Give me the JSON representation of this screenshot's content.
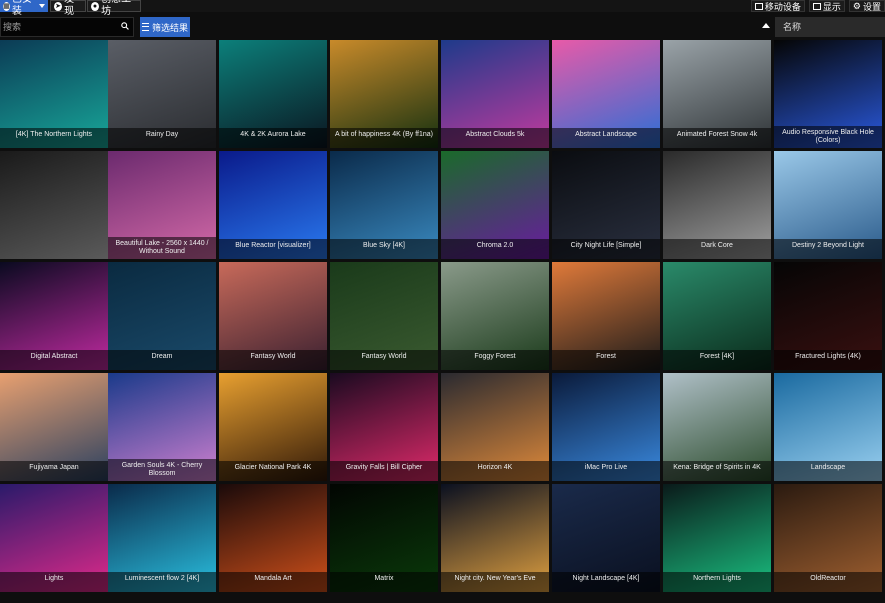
{
  "topbar": {
    "installed_label": "已安装",
    "discover_label": "发现",
    "workshop_label": "创意工坊",
    "mobile_label": "移动设备",
    "display_label": "显示",
    "settings_label": "设置"
  },
  "toolbar": {
    "search_placeholder": "搜索",
    "filter_label": "筛选结果",
    "sort_label": "名称"
  },
  "wallpapers": [
    {
      "title": "[4K] The Northern Lights",
      "colors": [
        "#0b3b55",
        "#18a89a"
      ]
    },
    {
      "title": "Rainy Day",
      "colors": [
        "#5a5e66",
        "#2a2c30"
      ]
    },
    {
      "title": "4K & 2K Aurora Lake",
      "colors": [
        "#0c7f7a",
        "#0b1520"
      ]
    },
    {
      "title": "A bit of happiness 4K (By ff1na)",
      "colors": [
        "#c88a2a",
        "#143010"
      ]
    },
    {
      "title": "Abstract Clouds 5k",
      "colors": [
        "#1e3a8a",
        "#c23a9e"
      ]
    },
    {
      "title": "Abstract Landscape",
      "colors": [
        "#e85aa8",
        "#2a6fd6"
      ]
    },
    {
      "title": "Animated Forest Snow 4k",
      "colors": [
        "#9aa3a8",
        "#2e3336"
      ]
    },
    {
      "title": "Audio Responsive Black Hole (Colors)",
      "colors": [
        "#050505",
        "#2a5ae0"
      ]
    },
    {
      "title": "",
      "colors": [
        "#1a1a1a",
        "#5a5a5a"
      ]
    },
    {
      "title": "Beautiful Lake - 2560 x 1440 / Without Sound",
      "colors": [
        "#6b2a6e",
        "#d46aa8"
      ]
    },
    {
      "title": "Blue Reactor [visualizer]",
      "colors": [
        "#0a1a8a",
        "#2a7af0"
      ]
    },
    {
      "title": "Blue Sky [4K]",
      "colors": [
        "#0a2a4a",
        "#3a8ac0"
      ]
    },
    {
      "title": "Chroma 2.0",
      "colors": [
        "#1a6a2a",
        "#6a1aa0"
      ]
    },
    {
      "title": "City Night Life [Simple]",
      "colors": [
        "#0a0c10",
        "#2a3040"
      ]
    },
    {
      "title": "Dark Core",
      "colors": [
        "#2a2a2a",
        "#a0a0a0"
      ]
    },
    {
      "title": "Destiny 2 Beyond Light",
      "colors": [
        "#9ac8e8",
        "#2a5a8a"
      ]
    },
    {
      "title": "Digital Abstract",
      "colors": [
        "#0a0a20",
        "#c02aa0"
      ]
    },
    {
      "title": "Dream",
      "colors": [
        "#0a2a40",
        "#1a4a6a"
      ]
    },
    {
      "title": "Fantasy World",
      "colors": [
        "#c86a5a",
        "#3a2030"
      ]
    },
    {
      "title": "Fantasy World",
      "colors": [
        "#1a3a1a",
        "#3a5a30"
      ]
    },
    {
      "title": "Foggy Forest",
      "colors": [
        "#8a9a8a",
        "#1a3a1a"
      ]
    },
    {
      "title": "Forest",
      "colors": [
        "#e07a3a",
        "#1a1a1a"
      ]
    },
    {
      "title": "Forest [4K]",
      "colors": [
        "#2a8a6a",
        "#0a2a1a"
      ]
    },
    {
      "title": "Fractured Lights (4K)",
      "colors": [
        "#050505",
        "#3a1010"
      ]
    },
    {
      "title": "Fujiyama  Japan",
      "colors": [
        "#e8a070",
        "#2a4060"
      ]
    },
    {
      "title": "Garden Souls 4K - Cherry Blossom",
      "colors": [
        "#1a3a8a",
        "#d080d0"
      ]
    },
    {
      "title": "Glacier National Park 4K",
      "colors": [
        "#e8a030",
        "#301808"
      ]
    },
    {
      "title": "Gravity Falls | Bill Cipher",
      "colors": [
        "#1a0a20",
        "#e02a6a"
      ]
    },
    {
      "title": "Horizon 4K",
      "colors": [
        "#2a2a30",
        "#e08a3a"
      ]
    },
    {
      "title": "iMac Pro Live",
      "colors": [
        "#0a1a3a",
        "#3a8ae0"
      ]
    },
    {
      "title": "Kena: Bridge of Spirits in 4K",
      "colors": [
        "#b0c0c8",
        "#2a4a2a"
      ]
    },
    {
      "title": "Landscape",
      "colors": [
        "#1a6aa0",
        "#9ad0f0"
      ]
    },
    {
      "title": "Lights",
      "colors": [
        "#2a1a6a",
        "#e02a8a"
      ]
    },
    {
      "title": "Luminescent flow 2 [4K]",
      "colors": [
        "#0a2a4a",
        "#2ac0e0"
      ]
    },
    {
      "title": "Mandala Art",
      "colors": [
        "#1a0a0a",
        "#d0501a"
      ]
    },
    {
      "title": "Matrix",
      "colors": [
        "#020502",
        "#0a3a0a"
      ]
    },
    {
      "title": "Night city. New Year's Eve",
      "colors": [
        "#0a1020",
        "#e0a040"
      ]
    },
    {
      "title": "Night Landscape [4K]",
      "colors": [
        "#1a2a4a",
        "#0a1020"
      ]
    },
    {
      "title": "Northern Lights",
      "colors": [
        "#0a1a1a",
        "#1ac080"
      ]
    },
    {
      "title": "OldReactor",
      "colors": [
        "#2a1a10",
        "#a06030"
      ]
    }
  ]
}
